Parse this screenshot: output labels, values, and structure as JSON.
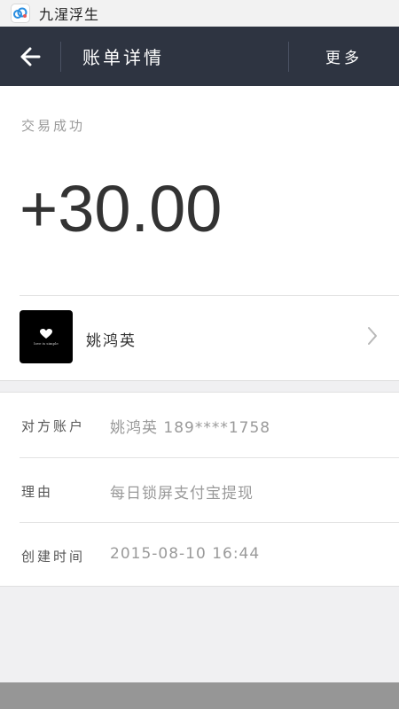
{
  "status_bar": {
    "app_icon": "cloud-app-icon",
    "title": "九湦浮生"
  },
  "nav": {
    "back_icon": "arrow-left-icon",
    "title": "账单详情",
    "more_label": "更多"
  },
  "transaction": {
    "status": "交易成功",
    "amount": "+30.00"
  },
  "payee": {
    "name": "姚鸿英",
    "avatar_text": "love is simple",
    "chevron_icon": "chevron-right-icon"
  },
  "details": [
    {
      "label": "对方账户",
      "value": "姚鸿英 189****1758"
    },
    {
      "label": "理由",
      "value": "每日锁屏支付宝提现"
    },
    {
      "label": "创建时间",
      "value": "2015-08-10 16:44"
    }
  ],
  "colors": {
    "nav_bg": "#2e3441",
    "amount_text": "#333333",
    "secondary_text": "#9a9a9a",
    "page_bg": "#f0f0f2"
  }
}
